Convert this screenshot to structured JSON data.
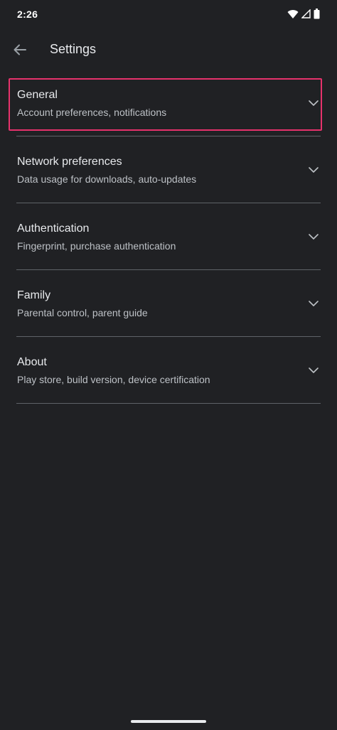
{
  "status_bar": {
    "time": "2:26",
    "icons": [
      "wifi-icon",
      "cell-signal-icon",
      "battery-icon"
    ]
  },
  "app_bar": {
    "back_icon": "arrow-back-icon",
    "title": "Settings"
  },
  "settings": [
    {
      "title": "General",
      "subtitle": "Account preferences, notifications",
      "icon": "chevron-down-icon",
      "highlighted": true
    },
    {
      "title": "Network preferences",
      "subtitle": "Data usage for downloads, auto-updates",
      "icon": "chevron-down-icon"
    },
    {
      "title": "Authentication",
      "subtitle": "Fingerprint, purchase authentication",
      "icon": "chevron-down-icon"
    },
    {
      "title": "Family",
      "subtitle": "Parental control, parent guide",
      "icon": "chevron-down-icon"
    },
    {
      "title": "About",
      "subtitle": "Play store, build version, device certification",
      "icon": "chevron-down-icon"
    }
  ],
  "colors": {
    "background": "#202124",
    "text_primary": "#e8eaed",
    "text_secondary": "#bdc1c6",
    "divider": "#5f6368",
    "highlight": "#e6326c"
  }
}
